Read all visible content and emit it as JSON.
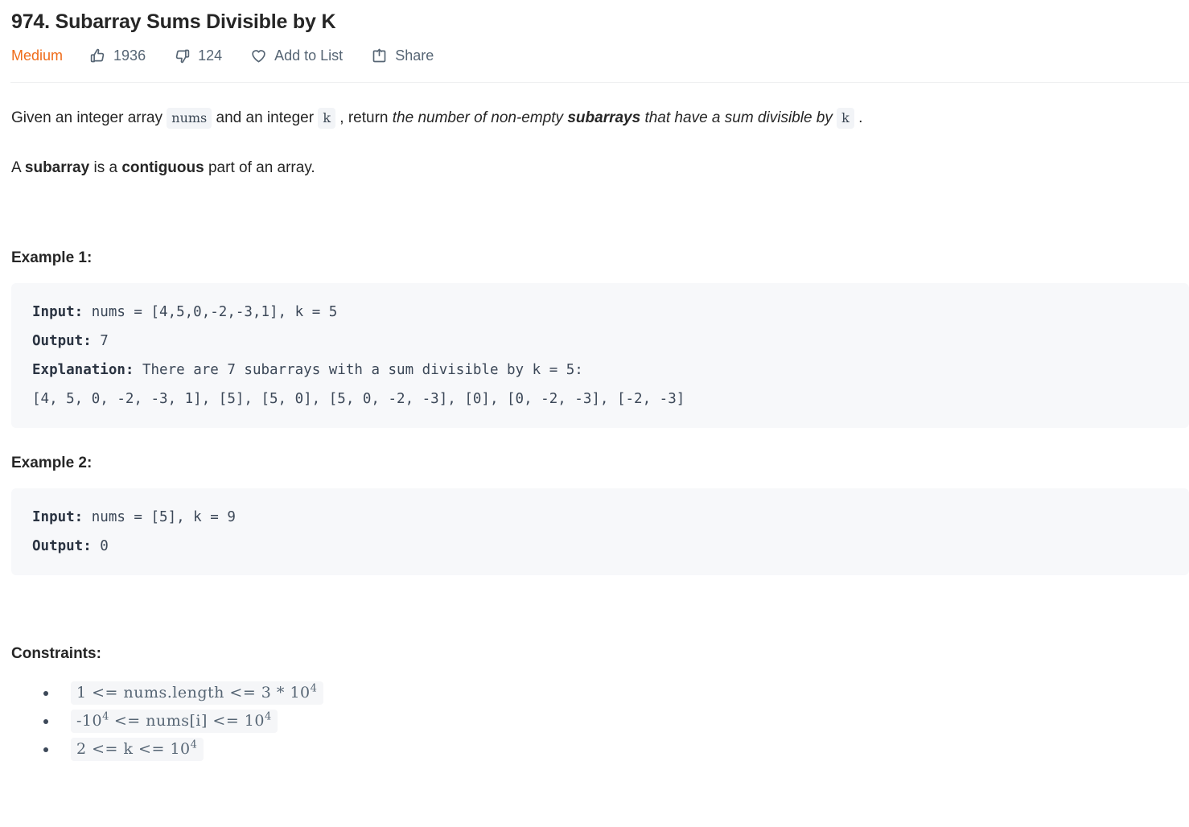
{
  "problem": {
    "title": "974. Subarray Sums Divisible by K",
    "difficulty": "Medium",
    "difficulty_color": "#ef6c1a",
    "actions": {
      "likes": {
        "icon": "thumbs-up-icon",
        "count": "1936"
      },
      "dislikes": {
        "icon": "thumbs-down-icon",
        "count": "124"
      },
      "add_to_list": {
        "icon": "heart-icon",
        "label": "Add to List"
      },
      "share": {
        "icon": "share-icon",
        "label": "Share"
      }
    }
  },
  "description": {
    "p1": {
      "t1": "Given an integer array ",
      "code1": "nums",
      "t2": " and an integer ",
      "code2": "k",
      "t3": " , return ",
      "em1": "the number of non-empty ",
      "em_strong": "subarrays",
      "em2": " that have a sum divisible by ",
      "code3": "k",
      "t4": " ."
    },
    "p2": {
      "t1": "A ",
      "b1": "subarray",
      "t2": " is a ",
      "b2": "contiguous",
      "t3": " part of an array."
    }
  },
  "examples": [
    {
      "heading": "Example 1:",
      "input_label": "Input:",
      "input_value": " nums = [4,5,0,-2,-3,1], k = 5",
      "output_label": "Output:",
      "output_value": " 7",
      "explanation_label": "Explanation:",
      "explanation_value": " There are 7 subarrays with a sum divisible by k = 5:\n[4, 5, 0, -2, -3, 1], [5], [5, 0], [5, 0, -2, -3], [0], [0, -2, -3], [-2, -3]"
    },
    {
      "heading": "Example 2:",
      "input_label": "Input:",
      "input_value": " nums = [5], k = 9",
      "output_label": "Output:",
      "output_value": " 0"
    }
  ],
  "constraints": {
    "heading": "Constraints:",
    "items": [
      {
        "pre": "1 <= nums.length <= 3 * 10",
        "sup": "4",
        "post": ""
      },
      {
        "pre": "-10",
        "sup": "4",
        "mid": " <= nums[i] <= 10",
        "sup2": "4",
        "post": ""
      },
      {
        "pre": "2 <= k <= 10",
        "sup": "4",
        "post": ""
      }
    ]
  }
}
